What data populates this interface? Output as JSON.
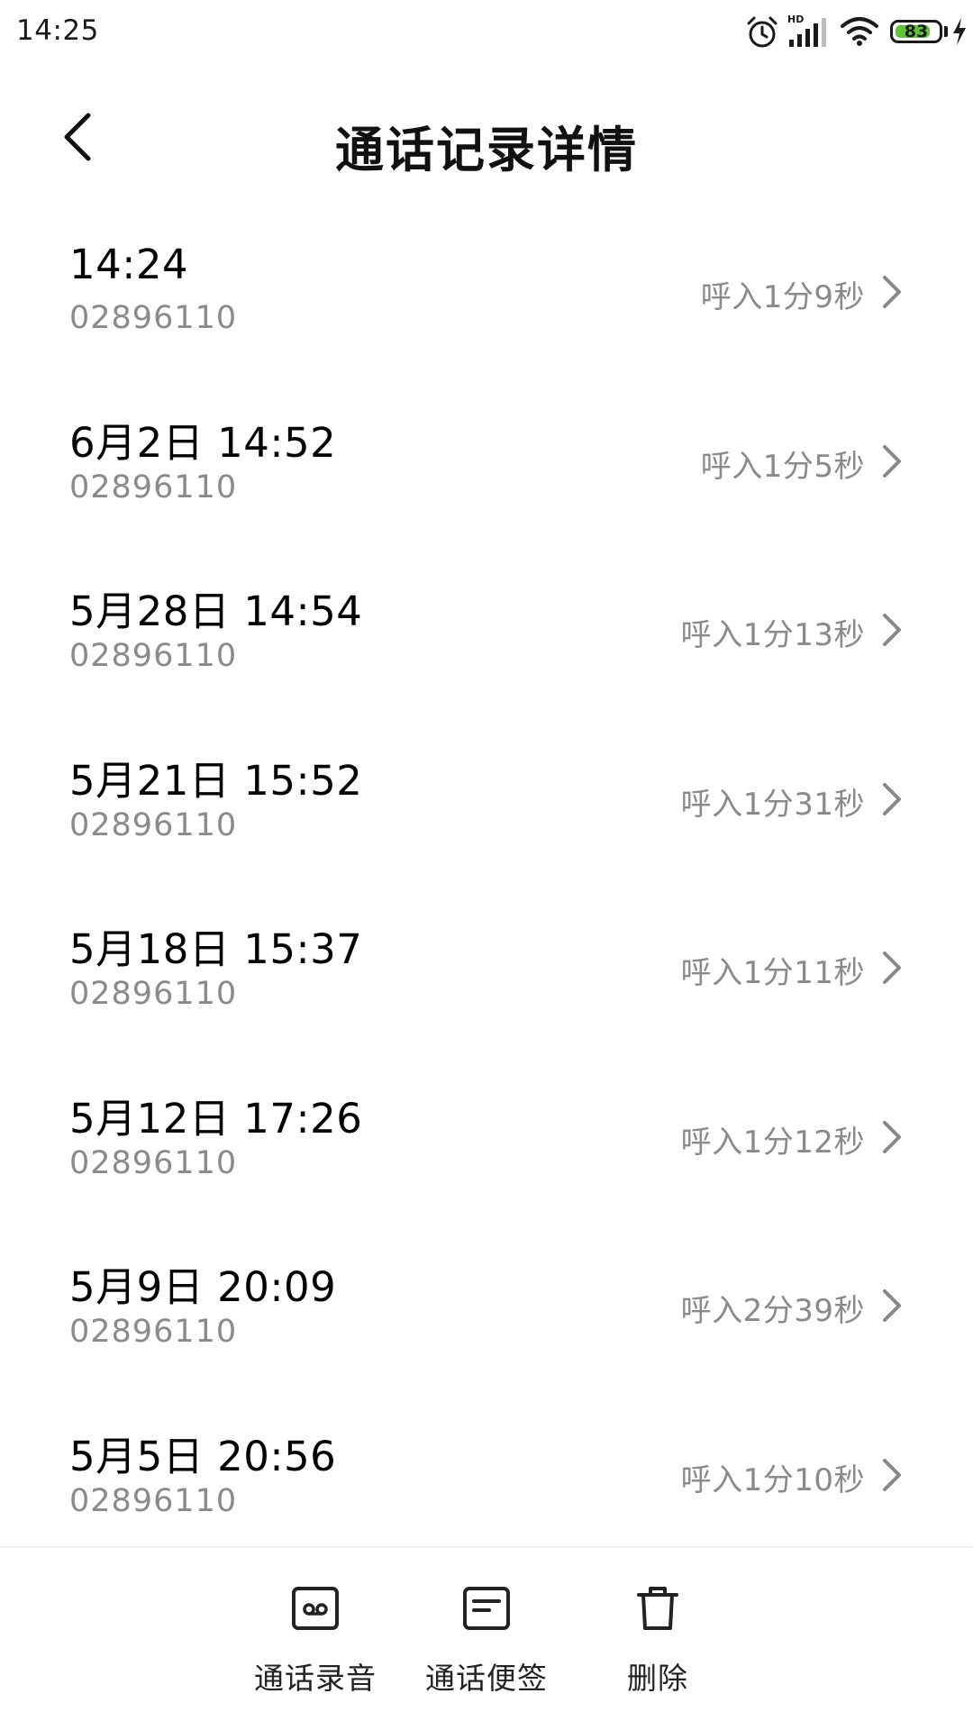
{
  "status_bar": {
    "time": "14:25",
    "battery_level": "83",
    "battery_color": "#5fc43a",
    "icons": [
      "alarm-icon",
      "hd-signal-icon",
      "wifi-icon",
      "battery-icon",
      "charging-icon"
    ]
  },
  "header": {
    "title": "通话记录详情",
    "back_icon": "back-arrow-icon"
  },
  "records": [
    {
      "datetime": "14:24",
      "number": "02896110",
      "duration": "呼入1分9秒"
    },
    {
      "datetime": "6月2日 14:52",
      "number": "02896110",
      "duration": "呼入1分5秒"
    },
    {
      "datetime": "5月28日 14:54",
      "number": "02896110",
      "duration": "呼入1分13秒"
    },
    {
      "datetime": "5月21日 15:52",
      "number": "02896110",
      "duration": "呼入1分31秒"
    },
    {
      "datetime": "5月18日 15:37",
      "number": "02896110",
      "duration": "呼入1分11秒"
    },
    {
      "datetime": "5月12日 17:26",
      "number": "02896110",
      "duration": "呼入1分12秒"
    },
    {
      "datetime": "5月9日 20:09",
      "number": "02896110",
      "duration": "呼入2分39秒"
    },
    {
      "datetime": "5月5日 20:56",
      "number": "02896110",
      "duration": "呼入1分10秒"
    }
  ],
  "bottom_bar": {
    "actions": [
      {
        "label": "通话录音",
        "icon": "recording-icon"
      },
      {
        "label": "通话便签",
        "icon": "note-icon"
      },
      {
        "label": "删除",
        "icon": "trash-icon"
      }
    ]
  }
}
